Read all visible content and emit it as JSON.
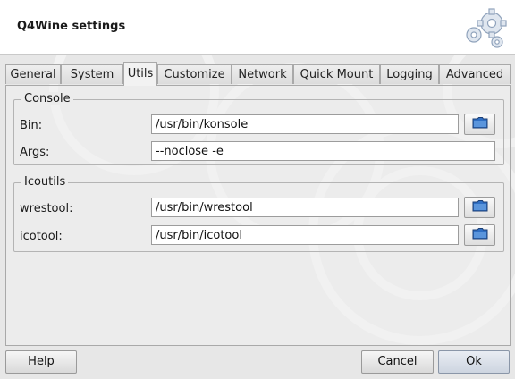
{
  "window": {
    "title": "Q4Wine settings"
  },
  "tabs": [
    {
      "label": "General"
    },
    {
      "label": "System"
    },
    {
      "label": "Utils",
      "active": true
    },
    {
      "label": "Customize"
    },
    {
      "label": "Network"
    },
    {
      "label": "Quick Mount"
    },
    {
      "label": "Logging"
    },
    {
      "label": "Advanced"
    }
  ],
  "console": {
    "group_title": "Console",
    "bin_label": "Bin:",
    "bin_value": "/usr/bin/konsole",
    "args_label": "Args:",
    "args_value": "--noclose -e"
  },
  "icoutils": {
    "group_title": "Icoutils",
    "wrestool_label": "wrestool:",
    "wrestool_value": "/usr/bin/wrestool",
    "icotool_label": "icotool:",
    "icotool_value": "/usr/bin/icotool"
  },
  "buttons": {
    "help": "Help",
    "cancel": "Cancel",
    "ok": "Ok"
  },
  "icons": {
    "header": "gears-icon",
    "browse": "folder-icon"
  },
  "colors": {
    "folder_blue": "#2f6fc4",
    "header_bg": "#ffffff",
    "dialog_bg": "#e7e7e7"
  }
}
